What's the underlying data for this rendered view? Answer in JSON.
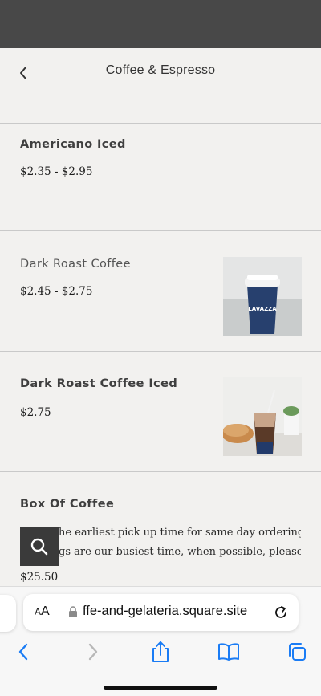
{
  "header": {
    "title": "Coffee & Espresso",
    "back_icon": "chevron-left-icon"
  },
  "items": [
    {
      "name": "Americano Iced",
      "price": "$2.35 - $2.95",
      "has_image": false
    },
    {
      "name": "Dark Roast Coffee",
      "price": "$2.45 - $2.75",
      "has_image": true,
      "image_label": "LAVAZZA"
    },
    {
      "name": "Dark Roast Coffee Iced",
      "price": "$2.75",
      "has_image": true
    },
    {
      "name": "Box Of Coffee",
      "description_line1": "he earliest pick up time for same day ordering .",
      "description_line2": "gs are our busiest time, when possible, please...",
      "price": "$25.50",
      "has_image": false
    }
  ],
  "search_fab": {
    "icon": "search-icon"
  },
  "browser": {
    "aa_label_small": "A",
    "aa_label_large": "A",
    "url": "ffe-and-gelateria.square.site",
    "toolbar": [
      "back-icon",
      "forward-icon",
      "share-icon",
      "bookmarks-icon",
      "tabs-icon"
    ]
  },
  "colors": {
    "status_strip": "#484848",
    "background": "#f2f1ef",
    "accent_blue": "#1a7cf5",
    "fab": "#3a3a3a"
  }
}
